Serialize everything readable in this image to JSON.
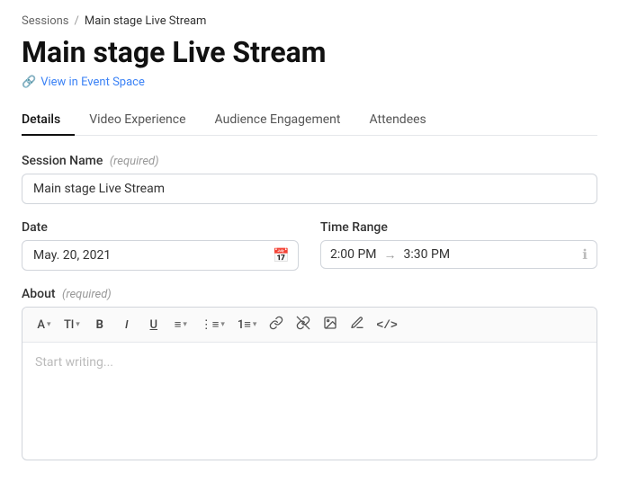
{
  "breadcrumb": {
    "parent_label": "Sessions",
    "separator": "/",
    "current_label": "Main stage Live Stream"
  },
  "page": {
    "title": "Main stage Live Stream",
    "view_link_label": "View in Event Space"
  },
  "tabs": [
    {
      "id": "details",
      "label": "Details",
      "active": true
    },
    {
      "id": "video-experience",
      "label": "Video Experience",
      "active": false
    },
    {
      "id": "audience-engagement",
      "label": "Audience Engagement",
      "active": false
    },
    {
      "id": "attendees",
      "label": "Attendees",
      "active": false
    }
  ],
  "form": {
    "session_name": {
      "label": "Session Name",
      "required_label": "(required)",
      "value": "Main stage Live Stream",
      "placeholder": ""
    },
    "date": {
      "label": "Date",
      "value": "May. 20, 2021"
    },
    "time_range": {
      "label": "Time Range",
      "start": "2:00 PM",
      "arrow": "→",
      "end": "3:30 PM"
    },
    "about": {
      "label": "About",
      "required_label": "(required)",
      "placeholder": "Start writing..."
    }
  },
  "toolbar": {
    "buttons": [
      {
        "id": "font-size",
        "label": "A",
        "has_chevron": true
      },
      {
        "id": "text-style",
        "label": "Tl",
        "has_chevron": true
      },
      {
        "id": "bold",
        "label": "B",
        "has_chevron": false
      },
      {
        "id": "italic",
        "label": "I",
        "has_chevron": false
      },
      {
        "id": "underline",
        "label": "U",
        "has_chevron": false
      },
      {
        "id": "align",
        "label": "≡",
        "has_chevron": true
      },
      {
        "id": "unordered-list",
        "label": "☰",
        "has_chevron": true
      },
      {
        "id": "ordered-list",
        "label": "≡",
        "has_chevron": true
      }
    ],
    "icon_buttons": [
      {
        "id": "link",
        "symbol": "🔗"
      },
      {
        "id": "unlink",
        "symbol": "⛓"
      },
      {
        "id": "image",
        "symbol": "🖼"
      },
      {
        "id": "highlight",
        "symbol": "✏"
      },
      {
        "id": "code",
        "symbol": "<>"
      }
    ]
  }
}
